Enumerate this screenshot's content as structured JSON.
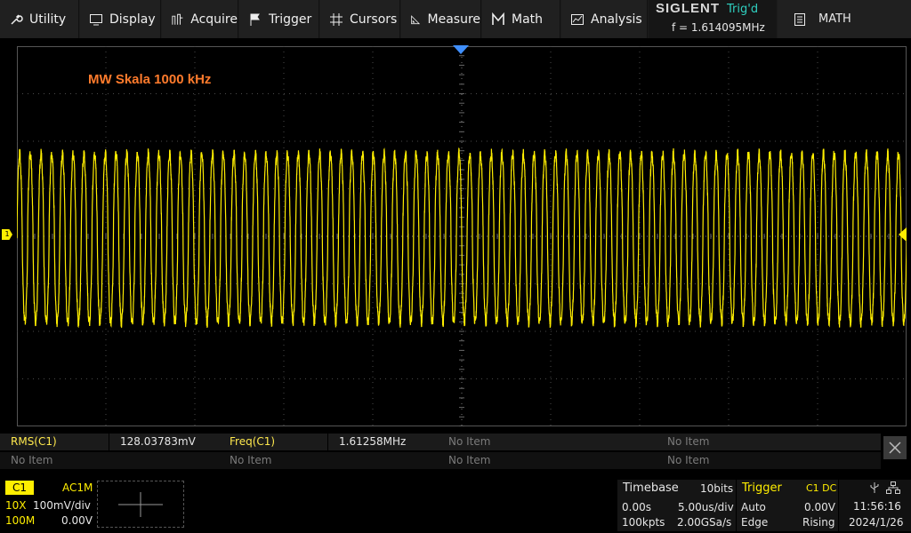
{
  "menu": {
    "items": [
      {
        "label": "Utility",
        "icon": "wrench-icon"
      },
      {
        "label": "Display",
        "icon": "monitor-icon"
      },
      {
        "label": "Acquire",
        "icon": "acquire-icon"
      },
      {
        "label": "Trigger",
        "icon": "flag-icon"
      },
      {
        "label": "Cursors",
        "icon": "crosshair-icon"
      },
      {
        "label": "Measure",
        "icon": "ruler-triangle-icon"
      },
      {
        "label": "Math",
        "icon": "math-m-icon"
      },
      {
        "label": "Analysis",
        "icon": "analysis-icon"
      }
    ]
  },
  "status": {
    "brand": "SIGLENT",
    "trigger_state": "Trig'd",
    "frequency": "f = 1.614095MHz"
  },
  "math_button": {
    "label": "MATH",
    "icon": "document-icon"
  },
  "waveform": {
    "label": "MW Skala 1000 kHz",
    "color": "#ffee00",
    "cycles": 83
  },
  "measurements": {
    "rows": [
      [
        {
          "name": "RMS(C1)",
          "value": "128.03783mV"
        },
        {
          "name": "Freq(C1)",
          "value": "1.61258MHz"
        },
        {
          "empty": "No Item"
        },
        {
          "empty": "No Item"
        }
      ],
      [
        {
          "empty": "No Item"
        },
        {
          "empty": "No Item"
        },
        {
          "empty": "No Item"
        },
        {
          "empty": "No Item"
        }
      ]
    ]
  },
  "channel1": {
    "tag": "C1",
    "coupling": "AC1M",
    "probe": "10X",
    "scale": "100mV/div",
    "bandwidth": "100M",
    "offset": "0.00V",
    "marker": "1"
  },
  "timebase": {
    "title": "Timebase",
    "bits": "10bits",
    "delay": "0.00s",
    "scale": "5.00us/div",
    "memory": "100kpts",
    "sample_rate": "2.00GSa/s"
  },
  "trigger": {
    "title": "Trigger",
    "source": "C1 DC",
    "mode": "Auto",
    "level": "0.00V",
    "type": "Edge",
    "slope": "Rising"
  },
  "clock": {
    "time": "11:56:16",
    "date": "2024/1/26"
  },
  "colors": {
    "accent": "#ffee00",
    "label": "#ff7b2c",
    "trig": "#2fd0c0"
  }
}
